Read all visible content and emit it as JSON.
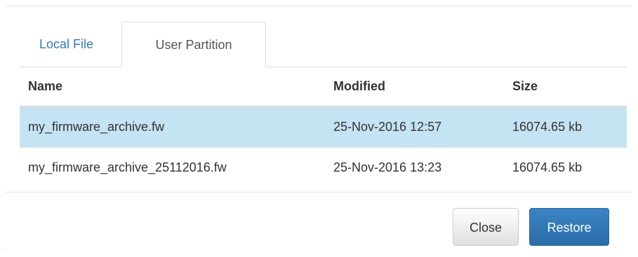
{
  "tabs": [
    {
      "label": "Local File",
      "active": false
    },
    {
      "label": "User Partition",
      "active": true
    }
  ],
  "table": {
    "headers": {
      "name": "Name",
      "modified": "Modified",
      "size": "Size"
    },
    "rows": [
      {
        "name": "my_firmware_archive.fw",
        "modified": "25-Nov-2016 12:57",
        "size": "16074.65 kb",
        "selected": true
      },
      {
        "name": "my_firmware_archive_25112016.fw",
        "modified": "25-Nov-2016 13:23",
        "size": "16074.65 kb",
        "selected": false
      }
    ]
  },
  "footer": {
    "close_label": "Close",
    "restore_label": "Restore"
  },
  "colors": {
    "accent": "#337ab7",
    "selected_row": "#c4e3f3",
    "primary_button": "#337ab7"
  }
}
